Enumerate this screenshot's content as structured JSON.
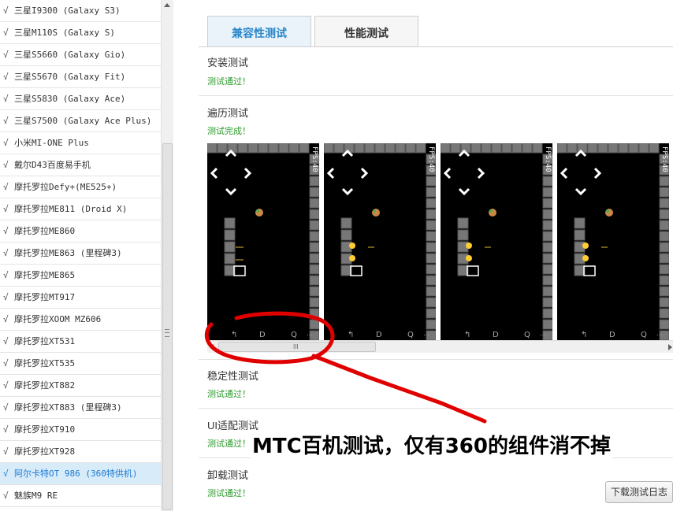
{
  "device_list": {
    "check_glyph": "√",
    "items": [
      {
        "label": "三星I9300 (Galaxy S3)"
      },
      {
        "label": "三星M110S (Galaxy S)"
      },
      {
        "label": "三星S5660 (Galaxy Gio)"
      },
      {
        "label": "三星S5670 (Galaxy Fit)"
      },
      {
        "label": "三星S5830 (Galaxy Ace)"
      },
      {
        "label": "三星S7500 (Galaxy Ace Plus)"
      },
      {
        "label": "小米MI-ONE Plus"
      },
      {
        "label": "戴尔D43百度易手机"
      },
      {
        "label": "摩托罗拉Defy+(ME525+)"
      },
      {
        "label": "摩托罗拉ME811 (Droid X)"
      },
      {
        "label": "摩托罗拉ME860"
      },
      {
        "label": "摩托罗拉ME863 (里程碑3)"
      },
      {
        "label": "摩托罗拉ME865"
      },
      {
        "label": "摩托罗拉MT917"
      },
      {
        "label": "摩托罗拉XOOM MZ606"
      },
      {
        "label": "摩托罗拉XT531"
      },
      {
        "label": "摩托罗拉XT535"
      },
      {
        "label": "摩托罗拉XT882"
      },
      {
        "label": "摩托罗拉XT883 (里程碑3)"
      },
      {
        "label": "摩托罗拉XT910"
      },
      {
        "label": "摩托罗拉XT928"
      },
      {
        "label": "阿尔卡特OT 986 (360特供机)",
        "selected": true
      },
      {
        "label": "魅族M9 RE"
      }
    ]
  },
  "tabs": [
    {
      "label": "兼容性测试",
      "active": true
    },
    {
      "label": "性能测试",
      "active": false
    }
  ],
  "sections": {
    "install": {
      "title": "安装测试",
      "status": "测试通过！"
    },
    "traverse": {
      "title": "遍历测试",
      "status": "测试完成！"
    },
    "stability": {
      "title": "稳定性测试",
      "status": "测试通过！"
    },
    "ui_adapt": {
      "title": "UI适配测试",
      "status": "测试通过！"
    },
    "uninstall": {
      "title": "卸载测试",
      "status": "测试通过！"
    }
  },
  "screenshots": {
    "fps_label": "FPS:40",
    "count": 4,
    "scroll_grip": "III"
  },
  "download_button": {
    "label": "下载测试日志"
  },
  "annotation": {
    "text": "MTC百机测试，仅有360的组件消不掉",
    "color": "#e00000"
  },
  "colors": {
    "accent": "#2a86c9",
    "status_green": "#2a9a2a",
    "selected_row_bg": "#d8ebf9"
  }
}
